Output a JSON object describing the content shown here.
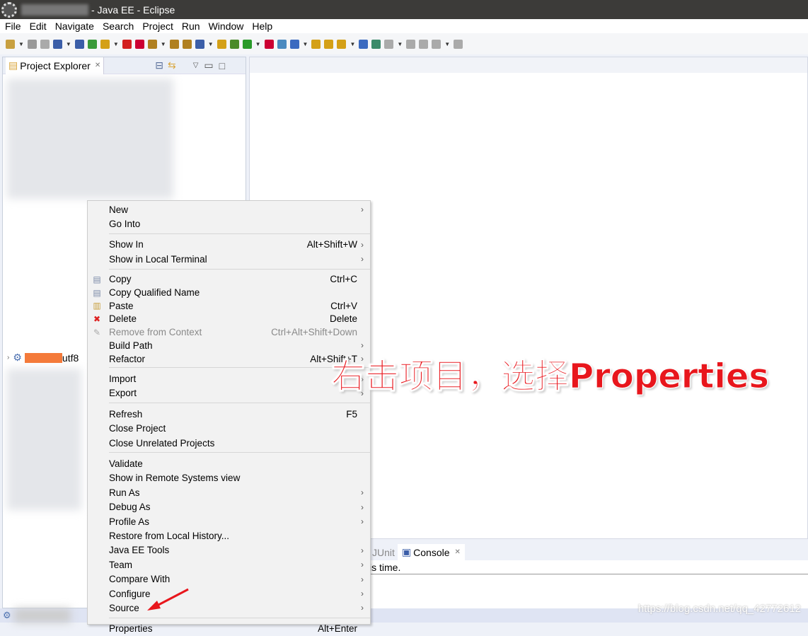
{
  "window": {
    "title": "- Java EE - Eclipse"
  },
  "menubar": [
    "File",
    "Edit",
    "Navigate",
    "Search",
    "Project",
    "Run",
    "Window",
    "Help"
  ],
  "project_explorer": {
    "tab_label": "Project Explorer",
    "project_suffix": "utf8"
  },
  "console": {
    "tabs": [
      "JUnit",
      "Console"
    ],
    "text": "is time."
  },
  "context_menu": {
    "groups": [
      [
        {
          "label": "New",
          "submenu": true
        },
        {
          "label": "Go Into"
        }
      ],
      [
        {
          "label": "Show In",
          "shortcut": "Alt+Shift+W",
          "submenu": true
        },
        {
          "label": "Show in Local Terminal",
          "submenu": true
        }
      ],
      [
        {
          "label": "Copy",
          "shortcut": "Ctrl+C",
          "icon": "copy-icon"
        },
        {
          "label": "Copy Qualified Name",
          "icon": "copy-qualified-icon"
        },
        {
          "label": "Paste",
          "shortcut": "Ctrl+V",
          "icon": "paste-icon"
        },
        {
          "label": "Delete",
          "shortcut": "Delete",
          "icon": "delete-icon"
        },
        {
          "label": "Remove from Context",
          "shortcut": "Ctrl+Alt+Shift+Down",
          "disabled": true,
          "icon": "remove-context-icon"
        },
        {
          "label": "Build Path",
          "submenu": true
        },
        {
          "label": "Refactor",
          "shortcut": "Alt+Shift+T",
          "submenu": true
        }
      ],
      [
        {
          "label": "Import",
          "submenu": true
        },
        {
          "label": "Export",
          "submenu": true
        }
      ],
      [
        {
          "label": "Refresh",
          "shortcut": "F5"
        },
        {
          "label": "Close Project"
        },
        {
          "label": "Close Unrelated Projects"
        }
      ],
      [
        {
          "label": "Validate"
        },
        {
          "label": "Show in Remote Systems view"
        },
        {
          "label": "Run As",
          "submenu": true
        },
        {
          "label": "Debug As",
          "submenu": true
        },
        {
          "label": "Profile As",
          "submenu": true
        },
        {
          "label": "Restore from Local History..."
        },
        {
          "label": "Java EE Tools",
          "submenu": true
        },
        {
          "label": "Team",
          "submenu": true
        },
        {
          "label": "Compare With",
          "submenu": true
        },
        {
          "label": "Configure",
          "submenu": true
        },
        {
          "label": "Source",
          "submenu": true
        }
      ],
      [
        {
          "label": "Properties",
          "shortcut": "Alt+Enter"
        }
      ]
    ]
  },
  "annotation": "右击项目，选择Properties",
  "watermark": "https://blog.csdn.net/qq_42772612",
  "colors": {
    "annotation": "#e8161c",
    "titlebar": "#3c3b39",
    "redaction": "#f47a3a"
  }
}
